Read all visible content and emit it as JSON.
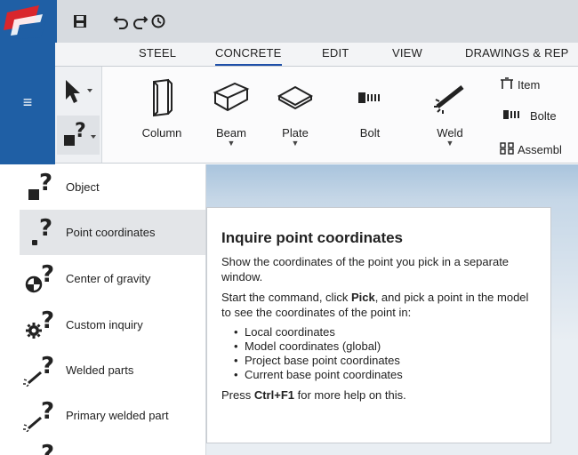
{
  "tabs": [
    "STEEL",
    "CONCRETE",
    "EDIT",
    "VIEW",
    "DRAWINGS & REP"
  ],
  "active_tab": "CONCRETE",
  "ribbon": {
    "column_label": "Column",
    "beam_label": "Beam",
    "plate_label": "Plate",
    "bolt_label": "Bolt",
    "weld_label": "Weld",
    "item_label": "Item",
    "bolted_label": "Bolte",
    "assembly_label": "Assembl"
  },
  "inquire_menu": [
    {
      "label": "Object",
      "icon": "inquire-object-icon"
    },
    {
      "label": "Point coordinates",
      "icon": "inquire-point-icon",
      "selected": true
    },
    {
      "label": "Center of gravity",
      "icon": "center-of-gravity-icon"
    },
    {
      "label": "Custom inquiry",
      "icon": "custom-inquiry-gear-icon"
    },
    {
      "label": "Welded parts",
      "icon": "welded-parts-icon"
    },
    {
      "label": "Primary welded part",
      "icon": "primary-welded-part-icon"
    }
  ],
  "tooltip": {
    "title": "Inquire point coordinates",
    "p1": "Show the coordinates of the point you pick in a separate window.",
    "p2_pre": "Start the command, click ",
    "p2_bold": "Pick",
    "p2_post": ", and pick a point in the model to see the coordinates of the point in:",
    "items": [
      "Local coordinates",
      "Model coordinates (global)",
      "Project base point coordinates",
      "Current base point coordinates"
    ],
    "help_pre": "Press ",
    "help_key": "Ctrl+F1",
    "help_post": " for more help on this."
  },
  "colors": {
    "sidebar_blue": "#1f5fa5",
    "logo_red": "#d9262c",
    "active_tab_underline": "#1e4fa8"
  }
}
